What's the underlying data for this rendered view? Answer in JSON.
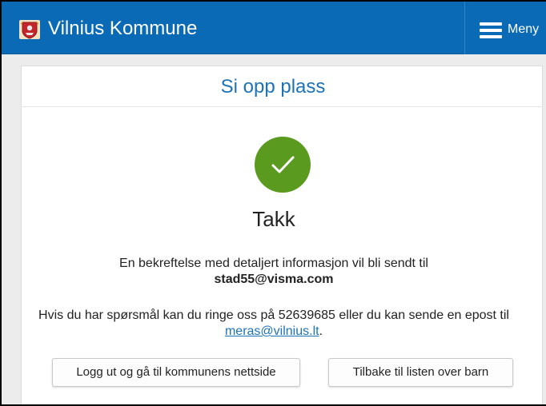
{
  "header": {
    "app_title": "Vilnius Kommune",
    "menu_label": "Meny",
    "logo_icon": "coat-of-arms-icon",
    "menu_icon": "hamburger-menu-icon"
  },
  "panel": {
    "title": "Si opp plass",
    "success_icon": "checkmark-icon",
    "heading": "Takk",
    "confirm_text": "En bekreftelse med detaljert informasjon vil bli sendt til",
    "confirm_email": "stad55@visma.com",
    "contact_text": "Hvis du har spørsmål kan du ringe oss på 52639685 eller du kan sende en epost til",
    "contact_link": "meras@vilnius.lt",
    "contact_suffix": "."
  },
  "actions": {
    "logout_label": "Logg ut og gå til kommunens nettside",
    "back_label": "Tilbake til listen over barn"
  },
  "colors": {
    "topbar": "#0a6ab6",
    "accent_text": "#1d73b8",
    "success": "#5a9a1f"
  }
}
